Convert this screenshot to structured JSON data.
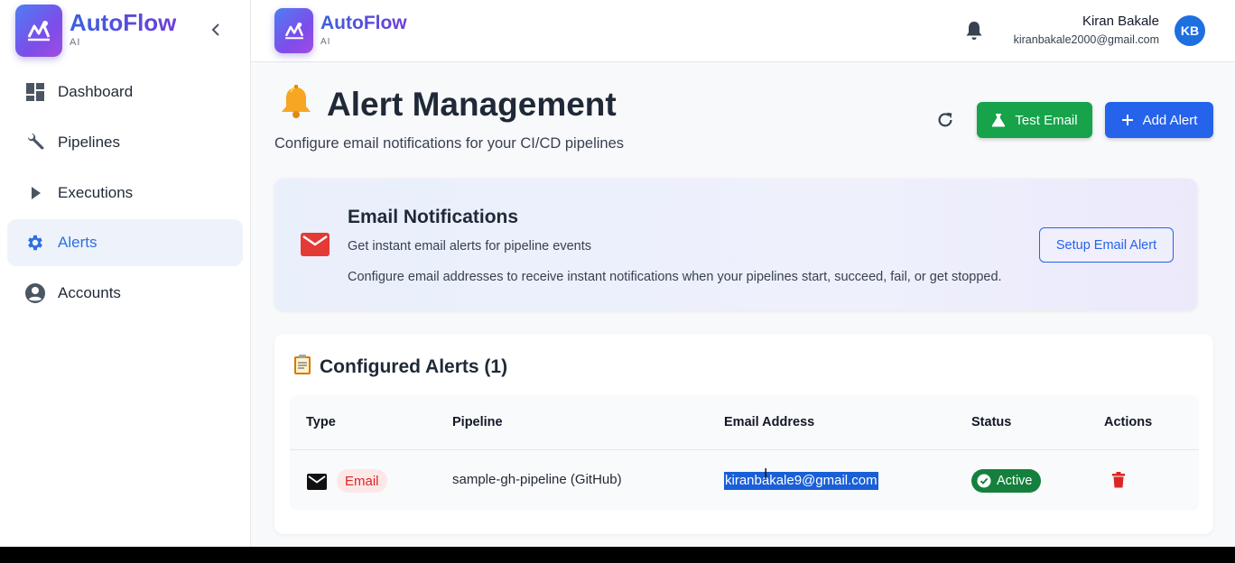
{
  "brand": {
    "name": "AutoFlow",
    "sub": "AI"
  },
  "sidebar": {
    "items": [
      {
        "label": "Dashboard",
        "icon": "dashboard-icon"
      },
      {
        "label": "Pipelines",
        "icon": "wrench-icon"
      },
      {
        "label": "Executions",
        "icon": "play-icon"
      },
      {
        "label": "Alerts",
        "icon": "gear-icon",
        "active": true
      },
      {
        "label": "Accounts",
        "icon": "account-circle-icon"
      }
    ]
  },
  "header": {
    "user_name": "Kiran Bakale",
    "user_email": "kiranbakale2000@gmail.com",
    "avatar_initials": "KB"
  },
  "page": {
    "title": "Alert Management",
    "subtitle": "Configure email notifications for your CI/CD pipelines",
    "test_email_label": "Test Email",
    "add_alert_label": "Add Alert"
  },
  "notifications": {
    "title": "Email Notifications",
    "subtitle": "Get instant email alerts for pipeline events",
    "description": "Configure email addresses to receive instant notifications when your pipelines start, succeed, fail, or get stopped.",
    "setup_label": "Setup Email Alert"
  },
  "alerts": {
    "title": "Configured Alerts (1)",
    "columns": [
      "Type",
      "Pipeline",
      "Email Address",
      "Status",
      "Actions"
    ],
    "rows": [
      {
        "type": "Email",
        "pipeline": "sample-gh-pipeline (GitHub)",
        "email": "kiranbakale9@gmail.com",
        "status": "Active"
      }
    ]
  },
  "colors": {
    "primary": "#2563eb",
    "success": "#16a34a",
    "danger": "#dc2626",
    "active_nav": "#2f6fe0"
  }
}
